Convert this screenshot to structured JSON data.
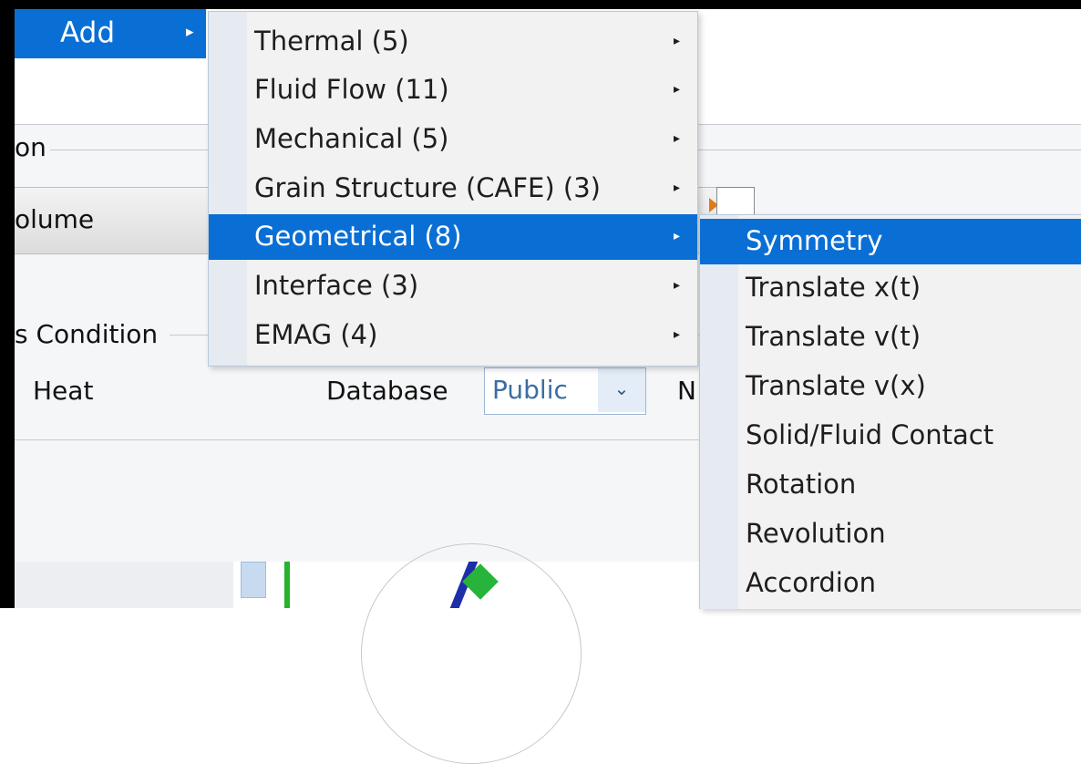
{
  "menubar": {
    "add_label": "Add",
    "add_arrow": "▸"
  },
  "background": {
    "group1_title": "on",
    "volume_text": "olume",
    "group2_title": "s Condition",
    "heat_label": "Heat",
    "database_label": "Database",
    "database_value": "Public",
    "dropdown_icon": "⌄",
    "truncated_label": "N"
  },
  "category_menu": {
    "items": [
      {
        "label": "Thermal (5)",
        "arrow": "▸"
      },
      {
        "label": "Fluid Flow (11)",
        "arrow": "▸"
      },
      {
        "label": "Mechanical (5)",
        "arrow": "▸"
      },
      {
        "label": "Grain Structure (CAFE) (3)",
        "arrow": "▸"
      },
      {
        "label": "Geometrical (8)",
        "arrow": "▸"
      },
      {
        "label": "Interface (3)",
        "arrow": "▸"
      },
      {
        "label": "EMAG (4)",
        "arrow": "▸"
      }
    ],
    "active_index": 4
  },
  "geometrical_submenu": {
    "items": [
      {
        "label": "Symmetry"
      },
      {
        "label": "Translate x(t)"
      },
      {
        "label": "Translate v(t)"
      },
      {
        "label": "Translate v(x)"
      },
      {
        "label": "Solid/Fluid Contact"
      },
      {
        "label": "Rotation"
      },
      {
        "label": "Revolution"
      },
      {
        "label": "Accordion"
      }
    ],
    "active_index": 0
  },
  "colors": {
    "accent": "#0a6fd4",
    "menu_bg": "#f2f2f2",
    "gutter": "#e6ebf2"
  }
}
